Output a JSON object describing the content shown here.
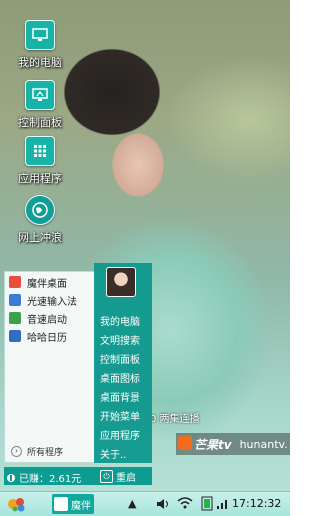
{
  "desktop": {
    "icons": [
      {
        "label": "我的电脑",
        "icon": "monitor-icon"
      },
      {
        "label": "控制面板",
        "icon": "control-panel-icon"
      },
      {
        "label": "应用程序",
        "icon": "apps-grid-icon"
      },
      {
        "label": "网上冲浪",
        "icon": "globe-icon"
      }
    ],
    "watermark": {
      "brand": "芒果tv",
      "site": "hunantv.",
      "subtitle": "0 两集连播"
    }
  },
  "start_menu": {
    "left_items": [
      {
        "label": "魔伴桌面",
        "icon": "mobun-desktop-icon",
        "color": "#e94f3c"
      },
      {
        "label": "光速输入法",
        "icon": "input-method-icon",
        "color": "#3b7bd6"
      },
      {
        "label": "音速启动",
        "icon": "launcher-icon",
        "color": "#3aa24a"
      },
      {
        "label": "哈哈日历",
        "icon": "calendar-icon",
        "color": "#2f6cc4"
      }
    ],
    "all_programs": "所有程序",
    "right_links": [
      "我的电脑",
      "文明搜索",
      "控制面板",
      "桌面图标",
      "桌面背景",
      "开始菜单",
      "应用程序",
      "关于.."
    ],
    "earned": "已赚：2.61元",
    "restart": "重启"
  },
  "taskbar": {
    "task_label": "魔伴",
    "clock": "17:12:32",
    "tray_icons": [
      "arrow-up-icon",
      "volume-icon",
      "wifi-icon",
      "battery-icon",
      "signal-icon"
    ]
  },
  "colors": {
    "accent": "#0d9c91",
    "taskbar": "#b4e8e0"
  }
}
